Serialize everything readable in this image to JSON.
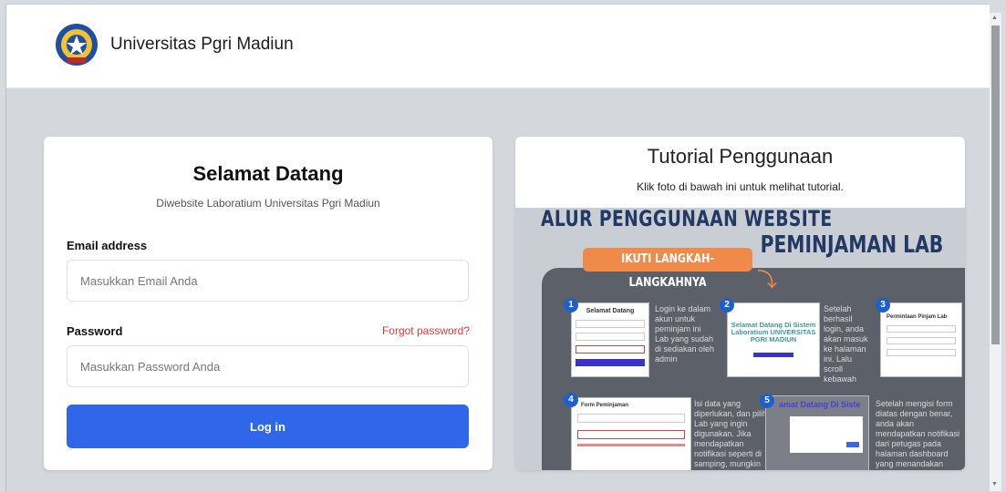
{
  "header": {
    "brand": "Universitas Pgri Madiun"
  },
  "login": {
    "title": "Selamat Datang",
    "subtitle": "Diwebsite Laboratium Universitas Pgri Madiun",
    "email_label": "Email address",
    "email_placeholder": "Masukkan Email Anda",
    "password_label": "Password",
    "forgot": "Forgot password?",
    "password_placeholder": "Masukkan Password Anda",
    "submit": "Log in"
  },
  "tutorial": {
    "title": "Tutorial Penggunaan",
    "subtitle": "Klik foto di bawah ini untuk melihat tutorial.",
    "poster": {
      "heading1": "ALUR PENGGUNAAN WEBSITE",
      "heading2": "PEMINJAMAN LAB",
      "banner": "IKUTI LANGKAH-LANGKAHNYA",
      "steps": [
        "1",
        "2",
        "3",
        "4",
        "5"
      ],
      "step1_text": "Login ke dalam akun untuk peminjam ini Lab yang sudah di sediakan oleh admin",
      "step2_text": "Setelah berhasil login, anda akan masuk ke halaman ini. Lalu scroll kebawah",
      "step4_text": "Isi data yang diperlukan, dan pilih Lab yang ingin digunakan. Jika mendapatkan notifikasi seperti di samping, mungkin lab",
      "step5_text": "Setelah mengisi form diatas dengan benar, anda akan mendapatkan notifikasi dari petugas pada halaman dashboard yang menandakan permintaan anda diterima",
      "shot1_title": "Selamat Datang",
      "shot2_title": "Selamat Datang Di Sistem Laboratium UNIVERSITAS PGRI MADIUN",
      "shot3_title": "Permintaan Pinjam Lab",
      "shot5_title": "amat Datang Di Siste",
      "shot4_title": "Form Peminjaman"
    }
  },
  "colors": {
    "primary": "#2f66ea",
    "danger": "#d63b3b",
    "poster_accent": "#f08a4b",
    "poster_navy": "#213963"
  }
}
